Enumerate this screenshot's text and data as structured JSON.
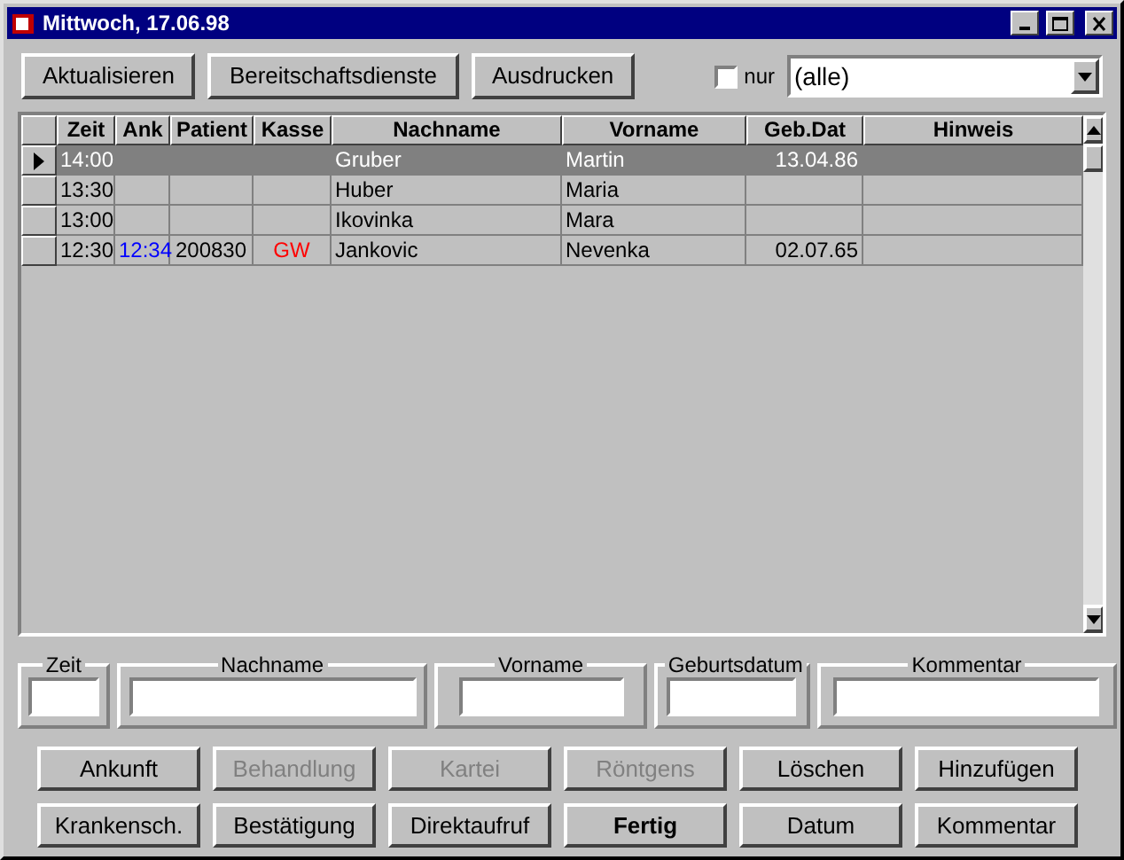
{
  "window": {
    "title": "Mittwoch, 17.06.98"
  },
  "toolbar": {
    "buttons": [
      "Aktualisieren",
      "Bereitschaftsdienste",
      "Ausdrucken"
    ],
    "filter": {
      "label": "nur",
      "checked": false
    },
    "dropdown": {
      "value": "(alle)"
    }
  },
  "table": {
    "columns": [
      "Zeit",
      "Ank",
      "Patient",
      "Kasse",
      "Nachname",
      "Vorname",
      "Geb.Dat",
      "Hinweis"
    ],
    "rows": [
      {
        "selected": true,
        "cells": [
          "14:00",
          null,
          null,
          null,
          "Gruber",
          "Martin",
          "13.04.86",
          null
        ]
      },
      {
        "selected": false,
        "cells": [
          "13:30",
          null,
          null,
          null,
          "Huber",
          "Maria",
          null,
          null
        ]
      },
      {
        "selected": false,
        "cells": [
          "13:00",
          null,
          null,
          null,
          "Ikovinka",
          "Mara",
          null,
          null
        ]
      },
      {
        "selected": false,
        "cells": [
          "12:30",
          "12:34",
          "200830",
          "GW",
          "Jankovic",
          "Nevenka",
          "02.07.65",
          null
        ]
      }
    ]
  },
  "fields": [
    {
      "label": "Zeit"
    },
    {
      "label": "Nachname"
    },
    {
      "label": "Vorname"
    },
    {
      "label": "Geburtsdatum"
    },
    {
      "label": "Kommentar"
    }
  ],
  "buttons": [
    {
      "label": "Ankunft",
      "disabled": false,
      "default": false
    },
    {
      "label": "Behandlung",
      "disabled": true,
      "default": false
    },
    {
      "label": "Kartei",
      "disabled": true,
      "default": false
    },
    {
      "label": "Röntgens",
      "disabled": true,
      "default": false
    },
    {
      "label": "Löschen",
      "disabled": false,
      "default": false
    },
    {
      "label": "Hinzufügen",
      "disabled": false,
      "default": false
    },
    {
      "label": "Krankensch.",
      "disabled": false,
      "default": false
    },
    {
      "label": "Bestätigung",
      "disabled": false,
      "default": false
    },
    {
      "label": "Direktaufruf",
      "disabled": false,
      "default": false
    },
    {
      "label": "Fertig",
      "disabled": false,
      "default": true
    },
    {
      "label": "Datum",
      "disabled": false,
      "default": false
    },
    {
      "label": "Kommentar",
      "disabled": false,
      "default": false
    }
  ]
}
